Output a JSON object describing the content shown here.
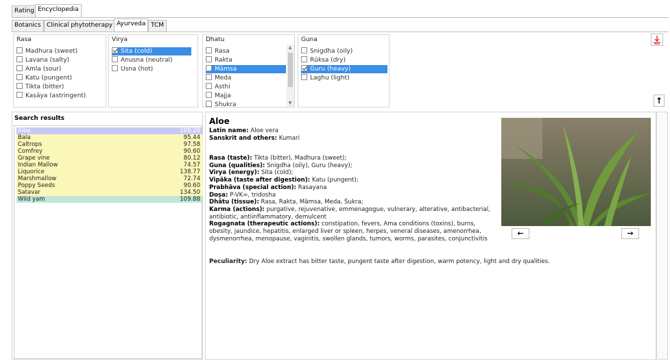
{
  "top_tabs": [
    "Rating",
    "Encyclopedia"
  ],
  "sub_tabs": [
    "Botanics",
    "Clinical phytotherapy",
    "Ayurveda",
    "TCM"
  ],
  "rasa": {
    "title": "Rasa",
    "items": [
      {
        "label": "Madhura (sweet)",
        "checked": false
      },
      {
        "label": "Lavana (salty)",
        "checked": false
      },
      {
        "label": "Amla (sour)",
        "checked": false
      },
      {
        "label": "Katu (pungent)",
        "checked": false
      },
      {
        "label": "Tikta (bitter)",
        "checked": false
      },
      {
        "label": "Kaṣāya (astringent)",
        "checked": false
      }
    ]
  },
  "virya": {
    "title": "Virya",
    "items": [
      {
        "label": "Sita (cold)",
        "checked": true,
        "selected": true
      },
      {
        "label": "Anusna (neutral)",
        "checked": false
      },
      {
        "label": "Usna (hot)",
        "checked": false
      }
    ]
  },
  "dhatu": {
    "title": "Dhatu",
    "items": [
      {
        "label": "Rasa",
        "checked": false
      },
      {
        "label": "Rakta",
        "checked": false
      },
      {
        "label": "Māmsa",
        "checked": false,
        "selected": true
      },
      {
        "label": "Meda",
        "checked": false
      },
      {
        "label": "Asthi",
        "checked": false
      },
      {
        "label": "Majja",
        "checked": false
      },
      {
        "label": "Shukra",
        "checked": false
      }
    ]
  },
  "guna": {
    "title": "Guna",
    "items": [
      {
        "label": "Snigdha (oily)",
        "checked": false
      },
      {
        "label": "Rūksa (dry)",
        "checked": false
      },
      {
        "label": "Guru (heavy)",
        "checked": true,
        "selected": true
      },
      {
        "label": "Laghu (light)",
        "checked": false
      }
    ]
  },
  "search_results": {
    "title": "Search results",
    "rows": [
      {
        "name": "Aloe",
        "value": "109.20",
        "style": "selected"
      },
      {
        "name": "Bala",
        "value": "95.44",
        "style": "yellow"
      },
      {
        "name": "Caltrops",
        "value": "97.58",
        "style": "yellow"
      },
      {
        "name": "Comfrey",
        "value": "90.60",
        "style": "yellow"
      },
      {
        "name": "Grape vine",
        "value": "80.12",
        "style": "yellow"
      },
      {
        "name": "Indian Mallow",
        "value": "74.57",
        "style": "yellow"
      },
      {
        "name": "Liquorice",
        "value": "138.77",
        "style": "yellow"
      },
      {
        "name": "Marshmallow",
        "value": "72.74",
        "style": "yellow"
      },
      {
        "name": "Poppy Seeds",
        "value": "90.60",
        "style": "yellow"
      },
      {
        "name": "Satavar",
        "value": "134.50",
        "style": "yellow"
      },
      {
        "name": "Wild yam",
        "value": "109.88",
        "style": "teal"
      }
    ]
  },
  "detail": {
    "name": "Aloe",
    "latin_label": "Latin name:",
    "latin": "Aloe vera",
    "sanskrit_label": "Sanskrit and others:",
    "sanskrit": "Kumari",
    "rasa_label": "Rasa (taste):",
    "rasa": "Tikta (bitter), Madhura (sweet);",
    "guna_label": "Guna (qualities):",
    "guna": "Snigdha (oily), Guru (heavy);",
    "virya_label": "Virya (energy):",
    "virya": "Sita (cold);",
    "vipaka_label": "Vipāka (taste after digestion):",
    "vipaka": "Katu (pungent);",
    "prabhava_label": "Prabhāva (special action):",
    "prabhava": "Rasayana",
    "dosa_label": "Doṣa:",
    "dosa": "P-VK=, tridosha",
    "dhatu_label": "Dhātu (tissue):",
    "dhatu": "Rasa, Rakta, Māmsa, Meda, Śukra;",
    "karma_label": "Karma (actions):",
    "karma": "purgative, rejuvenative, emmenagogue, vulnerary, alterative, antibacterial, antibiotic, antiinflammatory, demulcent",
    "rogagnata_label": "Rogagnata (therapeutic actions):",
    "rogagnata": "constipation, fevers, Ama conditions (toxins), burns, obesity, jaundice, hepatitis, enlarged liver or spleen, herpes, veneral diseases, amenorrhea, dysmenorrhea, menopause, vaginitis, swollen glands, tumors, worms, parasites, conjunctivitis",
    "peculiarity_label": "Peculiarity:",
    "peculiarity": "Dry Aloe extract has bitter taste, pungent taste after digestion, warm potency, light and dry qualities."
  },
  "image_nav": {
    "prev": "←",
    "next": "→"
  },
  "scroll_up_button": "↑",
  "colors": {
    "selection": "#3a8ee6",
    "yellow_row": "#fbf7b8",
    "teal_row": "#bfe6d6",
    "selected_row": "#c9c9f5"
  },
  "icons": [
    "pdf-icon",
    "arrow-up-icon",
    "arrow-left-icon",
    "arrow-right-icon"
  ]
}
